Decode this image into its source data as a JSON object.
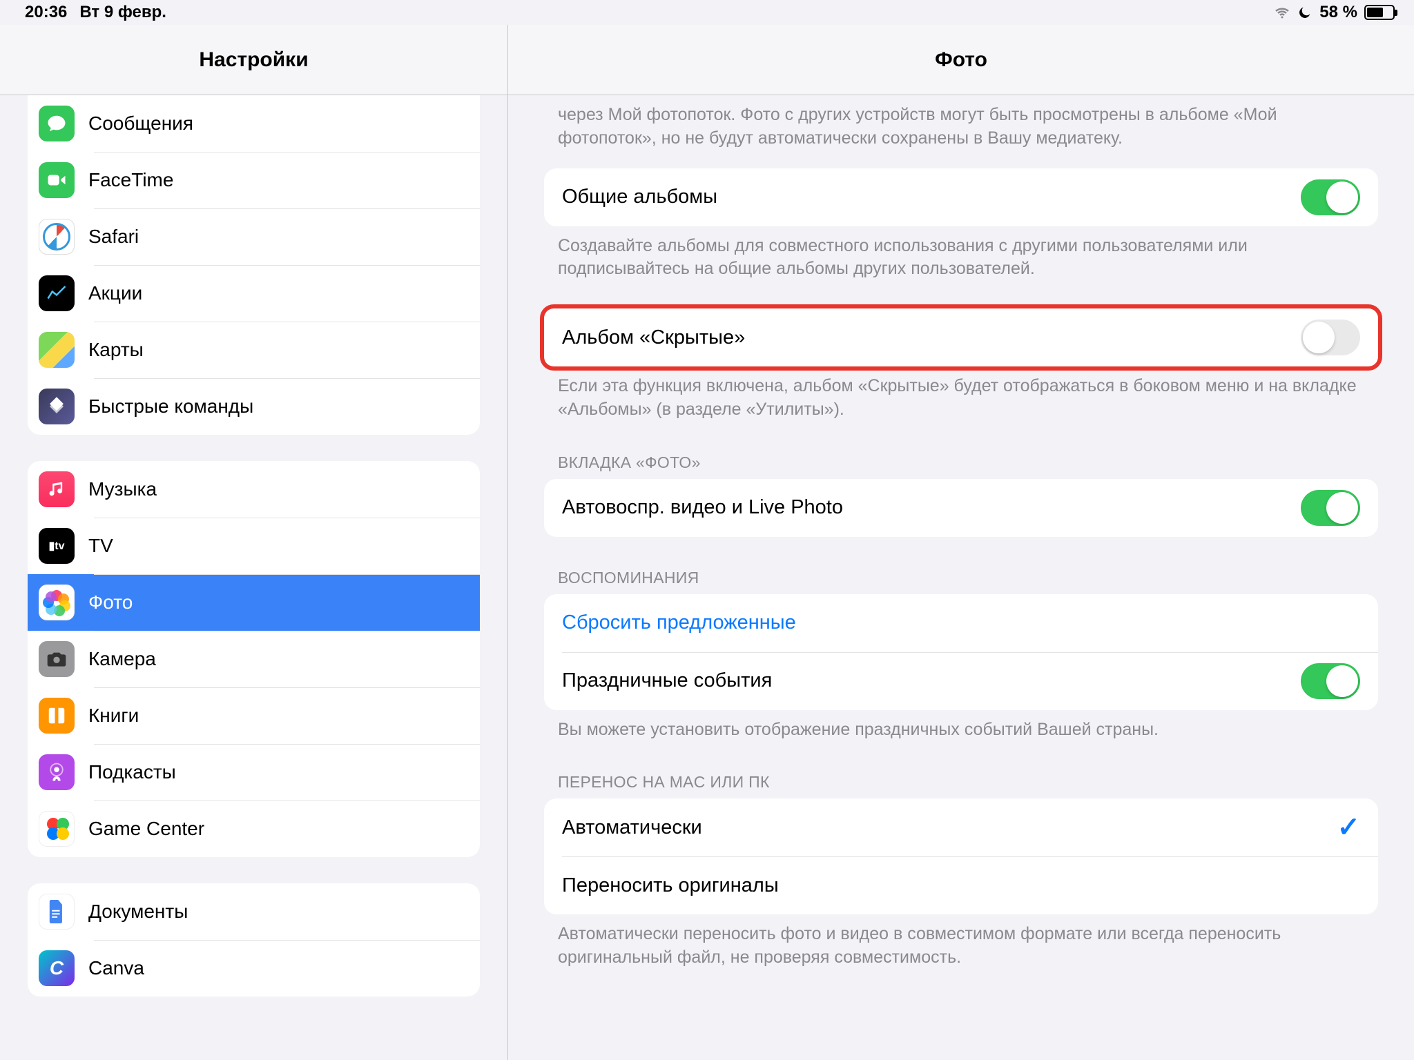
{
  "status": {
    "time": "20:36",
    "date": "Вт 9 февр.",
    "battery": "58 %"
  },
  "sidebar": {
    "title": "Настройки",
    "groups": [
      {
        "idx": 0,
        "items": [
          {
            "label": "Сообщения",
            "icon": "messages"
          },
          {
            "label": "FaceTime",
            "icon": "facetime"
          },
          {
            "label": "Safari",
            "icon": "safari"
          },
          {
            "label": "Акции",
            "icon": "stocks"
          },
          {
            "label": "Карты",
            "icon": "maps"
          },
          {
            "label": "Быстрые команды",
            "icon": "shortcuts"
          }
        ]
      },
      {
        "idx": 1,
        "items": [
          {
            "label": "Музыка",
            "icon": "music"
          },
          {
            "label": "TV",
            "icon": "tv"
          },
          {
            "label": "Фото",
            "icon": "photos",
            "selected": true
          },
          {
            "label": "Камера",
            "icon": "camera"
          },
          {
            "label": "Книги",
            "icon": "books"
          },
          {
            "label": "Подкасты",
            "icon": "podcasts"
          },
          {
            "label": "Game Center",
            "icon": "gc"
          }
        ]
      },
      {
        "idx": 2,
        "items": [
          {
            "label": "Документы",
            "icon": "docs"
          },
          {
            "label": "Canva",
            "icon": "canva"
          }
        ]
      }
    ]
  },
  "detail": {
    "title": "Фото",
    "photostream_note": "через Мой фотопоток. Фото с других устройств могут быть просмотрены в альбоме «Мой фотопоток», но не будут автоматически сохранены в Вашу медиатеку.",
    "shared_albums": "Общие альбомы",
    "shared_albums_note": "Создавайте альбомы для совместного использования с другими пользователями или подписывайтесь на общие альбомы других пользователей.",
    "hidden_album": "Альбом «Скрытые»",
    "hidden_album_note": "Если эта функция включена, альбом «Скрытые» будет отображаться в боковом меню и на вкладке «Альбомы» (в разделе «Утилиты»).",
    "photo_tab_header": "ВКЛАДКА «ФОТО»",
    "autoplay": "Автовоспр. видео и Live Photo",
    "memories_header": "ВОСПОМИНАНИЯ",
    "reset_suggested": "Сбросить предложенные",
    "holiday_events": "Праздничные события",
    "memories_note": "Вы можете установить отображение праздничных событий Вашей страны.",
    "transfer_header": "ПЕРЕНОС НА MAC ИЛИ ПК",
    "auto": "Автоматически",
    "originals": "Переносить оригиналы",
    "transfer_note": "Автоматически переносить фото и видео в совместимом формате или всегда переносить оригинальный файл, не проверяя совместимость."
  }
}
